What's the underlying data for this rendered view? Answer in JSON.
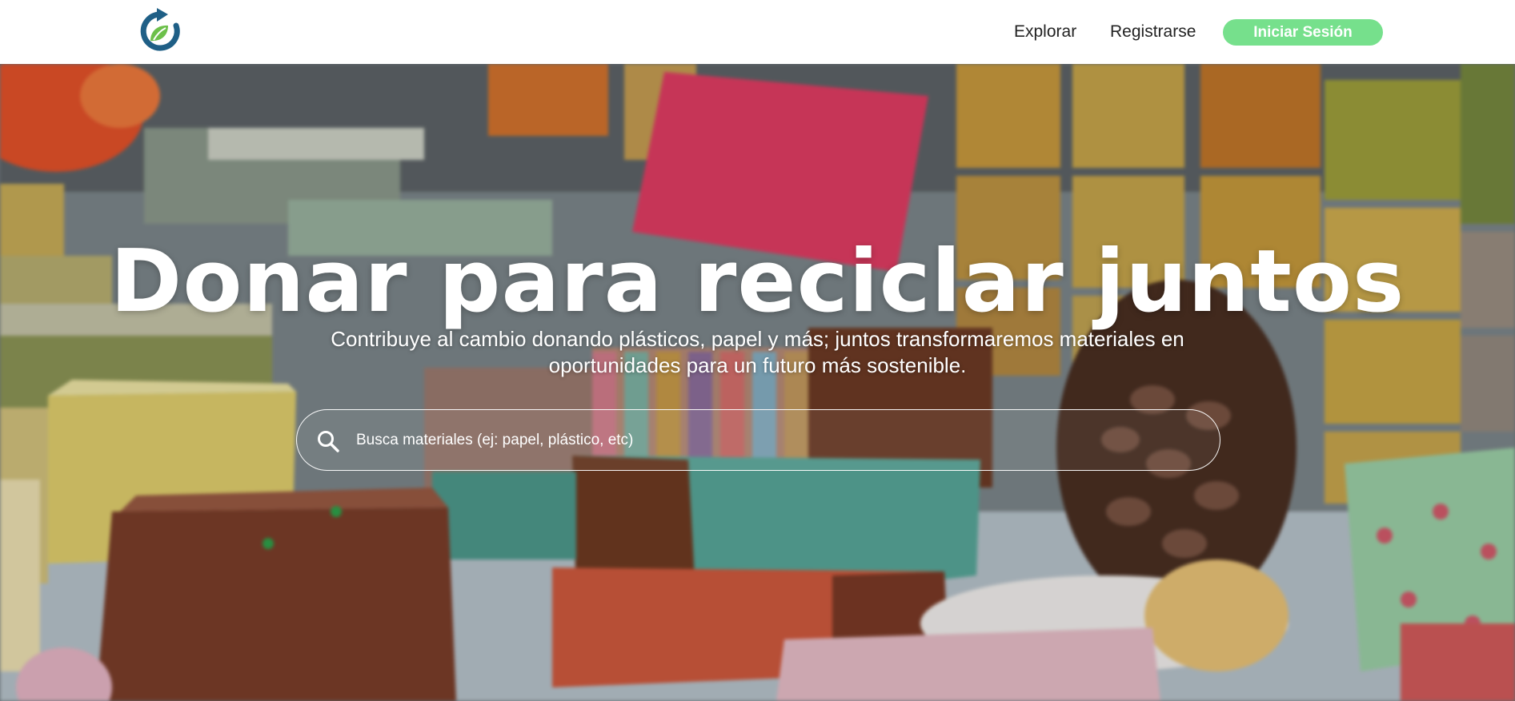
{
  "header": {
    "logo_icon": "recycle-leaf-logo-icon",
    "nav": {
      "explore_label": "Explorar",
      "register_label": "Registrarse",
      "login_label": "Iniciar Sesión"
    }
  },
  "hero": {
    "title": "Donar para reciclar juntos",
    "subtitle": "Contribuye al cambio donando plásticos, papel y más; juntos transformaremos materiales en oportunidades para un futuro más sostenible.",
    "search": {
      "placeholder": "Busca materiales (ej: papel, plástico, etc)",
      "icon": "search-icon"
    }
  },
  "colors": {
    "accent": "#76e08c",
    "logo_blue": "#1f5f86",
    "logo_green": "#6cc04a"
  }
}
